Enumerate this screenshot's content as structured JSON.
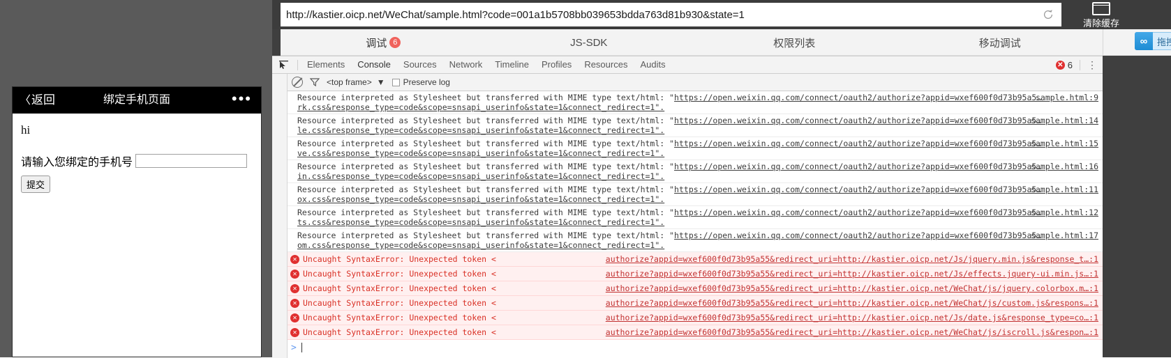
{
  "phone": {
    "back_label": "返回",
    "back_chevron": "〈",
    "title": "绑定手机页面",
    "menu_dots": "•••",
    "greeting": "hi",
    "form_label": "请输入您绑定的手机号",
    "input_value": "",
    "input_placeholder": "",
    "submit_label": "提交"
  },
  "browser": {
    "url": "http://kastier.oicp.net/WeChat/sample.html?code=001a1b5708bb039653bdda763d81b930&state=1",
    "reload_icon": "reload-icon",
    "clear_cache_label": "清除缓存",
    "clear_cache_icon": "code-window-icon"
  },
  "tabs": [
    {
      "label": "调试",
      "badge": "6",
      "active": true
    },
    {
      "label": "JS-SDK",
      "badge": "",
      "active": false
    },
    {
      "label": "权限列表",
      "badge": "",
      "active": false
    },
    {
      "label": "移动调试",
      "badge": "",
      "active": false
    }
  ],
  "upload": {
    "label": "拖拽上传",
    "icon": "link-upload-icon"
  },
  "devtools": {
    "inspect_icon": "inspect-cursor-icon",
    "panels": [
      {
        "label": "Elements",
        "active": false
      },
      {
        "label": "Console",
        "active": true
      },
      {
        "label": "Sources",
        "active": false
      },
      {
        "label": "Network",
        "active": false
      },
      {
        "label": "Timeline",
        "active": false
      },
      {
        "label": "Profiles",
        "active": false
      },
      {
        "label": "Resources",
        "active": false
      },
      {
        "label": "Audits",
        "active": false
      }
    ],
    "error_count": "6",
    "menu_icon": "vertical-dots-icon",
    "filterbar": {
      "clear_icon": "clear-console-icon",
      "filter_icon": "filter-funnel-icon",
      "frame_value": "<top frame>",
      "frame_caret": "▼",
      "preserve_log_label": "Preserve log",
      "preserve_log_checked": false
    },
    "prompt": ">"
  },
  "console_messages": [
    {
      "type": "warning",
      "line1_prefix": "Resource interpreted as Stylesheet but transferred with MIME type text/html: \"",
      "link": "https://open.weixin.qq.com/connect/oauth2/authorize?appid=wxef600f0d73b95a5…",
      "line2": "rk.css&response_type=code&scope=snsapi_userinfo&state=1&connect_redirect=1\".",
      "source": "sample.html:9"
    },
    {
      "type": "warning",
      "line1_prefix": "Resource interpreted as Stylesheet but transferred with MIME type text/html: \"",
      "link": "https://open.weixin.qq.com/connect/oauth2/authorize?appid=wxef600f0d73b95a5…",
      "line2": "le.css&response_type=code&scope=snsapi_userinfo&state=1&connect_redirect=1\".",
      "source": "sample.html:14"
    },
    {
      "type": "warning",
      "line1_prefix": "Resource interpreted as Stylesheet but transferred with MIME type text/html: \"",
      "link": "https://open.weixin.qq.com/connect/oauth2/authorize?appid=wxef600f0d73b95a5…",
      "line2": "ve.css&response_type=code&scope=snsapi_userinfo&state=1&connect_redirect=1\".",
      "source": "sample.html:15"
    },
    {
      "type": "warning",
      "line1_prefix": "Resource interpreted as Stylesheet but transferred with MIME type text/html: \"",
      "link": "https://open.weixin.qq.com/connect/oauth2/authorize?appid=wxef600f0d73b95a5…",
      "line2": "in.css&response_type=code&scope=snsapi_userinfo&state=1&connect_redirect=1\".",
      "source": "sample.html:16"
    },
    {
      "type": "warning",
      "line1_prefix": "Resource interpreted as Stylesheet but transferred with MIME type text/html: \"",
      "link": "https://open.weixin.qq.com/connect/oauth2/authorize?appid=wxef600f0d73b95a5…",
      "line2": "ox.css&response_type=code&scope=snsapi_userinfo&state=1&connect_redirect=1\".",
      "source": "sample.html:11"
    },
    {
      "type": "warning",
      "line1_prefix": "Resource interpreted as Stylesheet but transferred with MIME type text/html: \"",
      "link": "https://open.weixin.qq.com/connect/oauth2/authorize?appid=wxef600f0d73b95a5…",
      "line2": "ts.css&response_type=code&scope=snsapi_userinfo&state=1&connect_redirect=1\".",
      "source": "sample.html:12"
    },
    {
      "type": "warning",
      "line1_prefix": "Resource interpreted as Stylesheet but transferred with MIME type text/html: \"",
      "link": "https://open.weixin.qq.com/connect/oauth2/authorize?appid=wxef600f0d73b95a5…",
      "line2": "om.css&response_type=code&scope=snsapi_userinfo&state=1&connect_redirect=1\".",
      "source": "sample.html:17"
    },
    {
      "type": "error",
      "text": "Uncaught SyntaxError: Unexpected token <",
      "source": "authorize?appid=wxef600f0d73b95a55&redirect_uri=http://kastier.oicp.net/Js/jquery.min.js&response_t…:1"
    },
    {
      "type": "error",
      "text": "Uncaught SyntaxError: Unexpected token <",
      "source": "authorize?appid=wxef600f0d73b95a55&redirect_uri=http://kastier.oicp.net/Js/effects.jquery-ui.min.js…:1"
    },
    {
      "type": "error",
      "text": "Uncaught SyntaxError: Unexpected token <",
      "source": "authorize?appid=wxef600f0d73b95a55&redirect_uri=http://kastier.oicp.net/WeChat/js/jquery.colorbox.m…:1"
    },
    {
      "type": "error",
      "text": "Uncaught SyntaxError: Unexpected token <",
      "source": "authorize?appid=wxef600f0d73b95a55&redirect_uri=http://kastier.oicp.net/WeChat/js/custom.js&respons…:1"
    },
    {
      "type": "error",
      "text": "Uncaught SyntaxError: Unexpected token <",
      "source": "authorize?appid=wxef600f0d73b95a55&redirect_uri=http://kastier.oicp.net/Js/date.js&response_type=co…:1"
    },
    {
      "type": "error",
      "text": "Uncaught SyntaxError: Unexpected token <",
      "source": "authorize?appid=wxef600f0d73b95a55&redirect_uri=http://kastier.oicp.net/WeChat/js/iscroll.js&respon…:1"
    }
  ],
  "colors": {
    "accent_blue": "#1d8cd4",
    "error_red": "#d93025",
    "badge_red": "#f0625c",
    "chrome_dark": "#3c3c3c"
  }
}
